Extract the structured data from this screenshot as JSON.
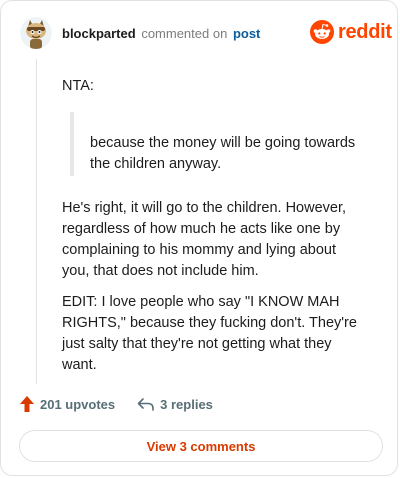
{
  "header": {
    "username": "blockparted",
    "action_text": "commented on",
    "post_link": "post",
    "brand": "reddit"
  },
  "comment": {
    "paragraphs": [
      "NTA:",
      "because the money will be going towards the children anyway.",
      "He's right, it will go to the children. However, regardless of how much he acts like one by complaining to his mommy and lying about you, that does not include him.",
      "EDIT: I love people who say \"I KNOW MAH RIGHTS,\" because they fucking don't. They're just salty that they're not getting what they want."
    ]
  },
  "footer": {
    "upvotes": "201 upvotes",
    "replies": "3 replies",
    "view_comments": "View 3 comments"
  },
  "colors": {
    "brand": "#ff4500",
    "upvote_arrow": "#d93a00",
    "link": "#0a5d9e"
  },
  "icons": {
    "avatar": "snoo-avatar-icon",
    "brand_logo": "reddit-logo-icon",
    "upvote": "upvote-arrow-icon",
    "reply": "reply-arrow-icon"
  }
}
